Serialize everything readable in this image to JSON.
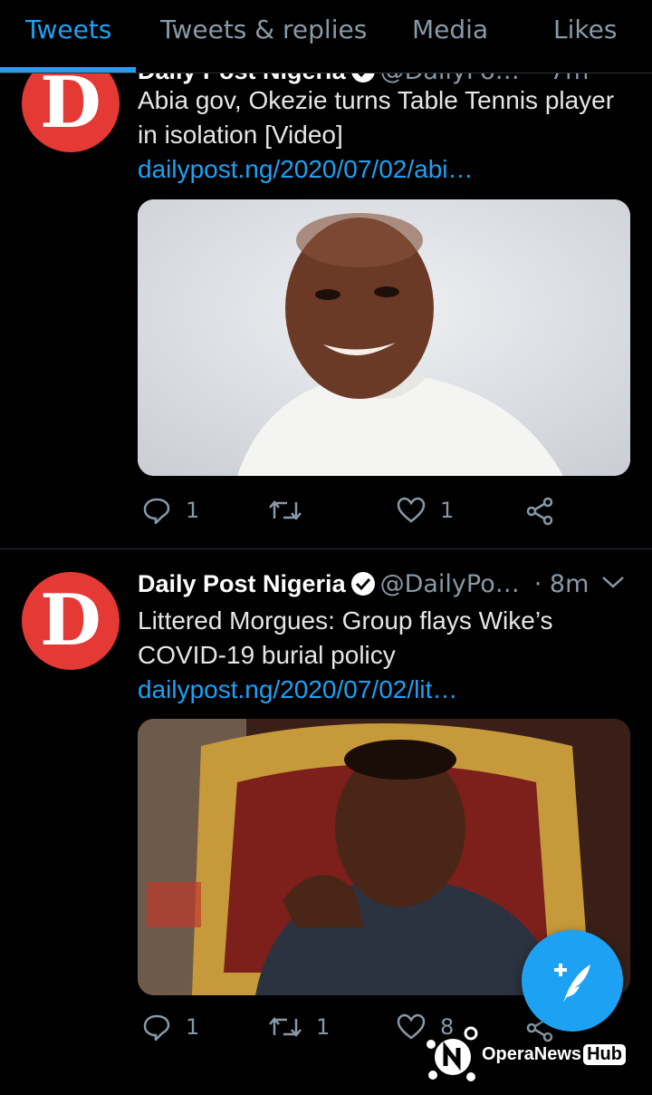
{
  "tabs": [
    {
      "label": "Tweets"
    },
    {
      "label": "Tweets & replies"
    },
    {
      "label": "Media"
    },
    {
      "label": "Likes"
    }
  ],
  "tweets": [
    {
      "avatar_letter": "D",
      "author_name": "Daily Post Nigeria",
      "author_handle": "@DailyPo…",
      "time": "· 7m",
      "text": "Abia gov, Okezie turns Table Tennis player in isolation [Video] ",
      "link": "dailypost.ng/2020/07/02/abi…",
      "image_alt": "photo-smiling-man-white-attire",
      "replies": "1",
      "retweets": "",
      "likes": "1"
    },
    {
      "avatar_letter": "D",
      "author_name": "Daily Post Nigeria",
      "author_handle": "@DailyPo…",
      "time": "· 8m",
      "text": "Littered Morgues: Group flays Wike’s COVID-19 burial policy ",
      "link": "dailypost.ng/2020/07/02/lit…",
      "image_alt": "photo-man-seated-gold-chair",
      "replies": "1",
      "retweets": "1",
      "likes": "8"
    }
  ],
  "watermark": {
    "brand": "OperaNews",
    "hub": "Hub"
  },
  "colors": {
    "accent": "#1da1f2",
    "background": "#000000",
    "avatar_red": "#e53935",
    "muted": "#8899a6"
  }
}
